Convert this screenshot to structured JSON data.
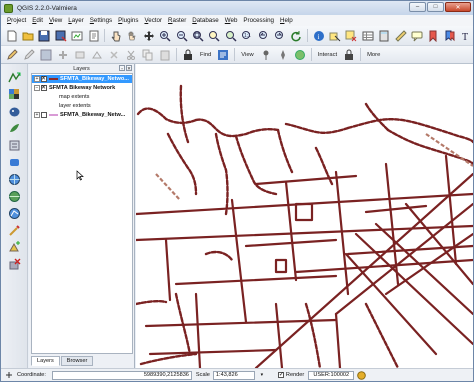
{
  "window": {
    "title": "QGIS 2.2.0-Valmiera",
    "minimize": "–",
    "maximize": "□",
    "close": "✕"
  },
  "menu": [
    {
      "key": "P",
      "rest": "roject"
    },
    {
      "key": "E",
      "rest": "dit"
    },
    {
      "key": "V",
      "rest": "iew"
    },
    {
      "key": "L",
      "rest": "ayer"
    },
    {
      "key": "S",
      "rest": "ettings"
    },
    {
      "key": "P",
      "rest": "lugins"
    },
    {
      "key": "V",
      "rest": "ector"
    },
    {
      "key": "R",
      "rest": "aster"
    },
    {
      "key": "D",
      "rest": "atabase"
    },
    {
      "key": "W",
      "rest": "eb"
    },
    {
      "key": "",
      "rest": "Processing"
    },
    {
      "key": "H",
      "rest": "elp"
    }
  ],
  "toolbar2": {
    "find": "Find",
    "view": "View",
    "interact": "Interact",
    "more": "More"
  },
  "layers_panel": {
    "title": "Layers",
    "float_btn": "▫",
    "close_btn": "✕",
    "tabs": [
      "Layers",
      "Browser"
    ],
    "items": [
      {
        "label": "SFMTA_Bikeway_Netwo...",
        "selected": true,
        "checked": true
      },
      {
        "label": "SFMTA Bikeway Network",
        "selected": false,
        "checked": true
      },
      {
        "label": "map extents",
        "selected": false
      },
      {
        "label": "layer extents",
        "selected": false
      },
      {
        "label": "SFMTA_Bikeway_Netw...",
        "selected": false,
        "checked": false
      }
    ]
  },
  "status": {
    "coordinate_label": "Coordinate:",
    "coordinate_value": "5989390,2125836",
    "scale_label": "Scale",
    "scale_value": "1:43,826",
    "render_label": "Render",
    "crs": "USER:100002"
  },
  "colors": {
    "route": "#7a2222",
    "route_dash": "#b47a6a",
    "selection": "#3399ff"
  }
}
